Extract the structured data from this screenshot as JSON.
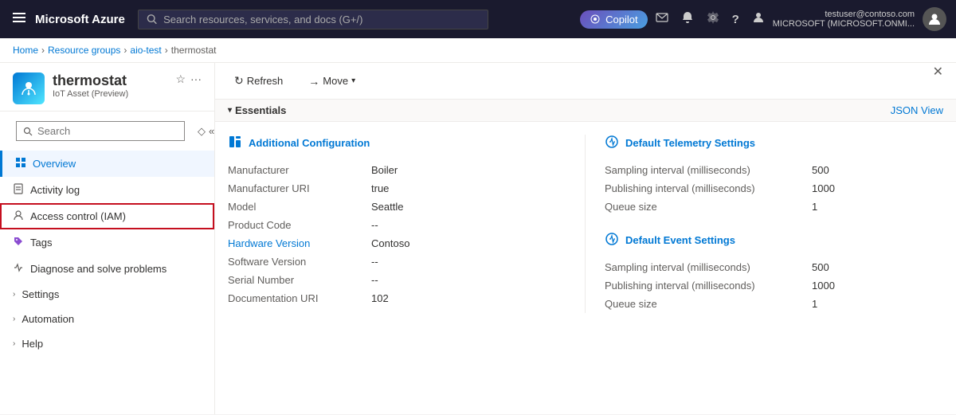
{
  "topbar": {
    "logo": "Microsoft Azure",
    "search_placeholder": "Search resources, services, and docs (G+/)",
    "copilot_label": "Copilot",
    "user_email": "testuser@contoso.com",
    "user_tenant": "MICROSOFT (MICROSOFT.ONMI...",
    "hamburger_icon": "☰",
    "search_icon": "🔍",
    "envelope_icon": "✉",
    "bell_icon": "🔔",
    "gear_icon": "⚙",
    "question_icon": "?",
    "person_icon": "👤"
  },
  "breadcrumb": {
    "items": [
      "Home",
      "Resource groups",
      "aio-test",
      "thermostat"
    ]
  },
  "resource": {
    "name": "thermostat",
    "type": "IoT Asset (Preview)"
  },
  "sidebar": {
    "search_placeholder": "Search",
    "nav_items": [
      {
        "id": "overview",
        "label": "Overview",
        "icon": "⊞",
        "active": true
      },
      {
        "id": "activity-log",
        "label": "Activity log",
        "icon": "📋"
      },
      {
        "id": "access-control",
        "label": "Access control (IAM)",
        "icon": "👥",
        "selected": true
      },
      {
        "id": "tags",
        "label": "Tags",
        "icon": "🏷"
      },
      {
        "id": "diagnose",
        "label": "Diagnose and solve problems",
        "icon": "🔧"
      }
    ],
    "groups": [
      {
        "id": "settings",
        "label": "Settings"
      },
      {
        "id": "automation",
        "label": "Automation"
      },
      {
        "id": "help",
        "label": "Help"
      }
    ]
  },
  "toolbar": {
    "refresh_label": "Refresh",
    "move_label": "Move",
    "refresh_icon": "↻",
    "move_icon": "→"
  },
  "essentials": {
    "title": "Essentials",
    "json_view_label": "JSON View"
  },
  "additional_config": {
    "title": "Additional Configuration",
    "icon": "🏗",
    "fields": [
      {
        "label": "Manufacturer",
        "value": "Boiler"
      },
      {
        "label": "Manufacturer URI",
        "value": "true"
      },
      {
        "label": "Model",
        "value": "Seattle"
      },
      {
        "label": "Product Code",
        "value": "--"
      },
      {
        "label": "Hardware Version",
        "value": "Contoso"
      },
      {
        "label": "Software Version",
        "value": "--"
      },
      {
        "label": "Serial Number",
        "value": "--"
      },
      {
        "label": "Documentation URI",
        "value": "102"
      }
    ]
  },
  "default_telemetry": {
    "title": "Default Telemetry Settings",
    "icon": "⚙",
    "fields": [
      {
        "label": "Sampling interval (milliseconds)",
        "value": "500"
      },
      {
        "label": "Publishing interval (milliseconds)",
        "value": "1000"
      },
      {
        "label": "Queue size",
        "value": "1"
      }
    ]
  },
  "default_event": {
    "title": "Default Event Settings",
    "icon": "⚙",
    "fields": [
      {
        "label": "Sampling interval (milliseconds)",
        "value": "500"
      },
      {
        "label": "Publishing interval (milliseconds)",
        "value": "1000"
      },
      {
        "label": "Queue size",
        "value": "1"
      }
    ]
  }
}
